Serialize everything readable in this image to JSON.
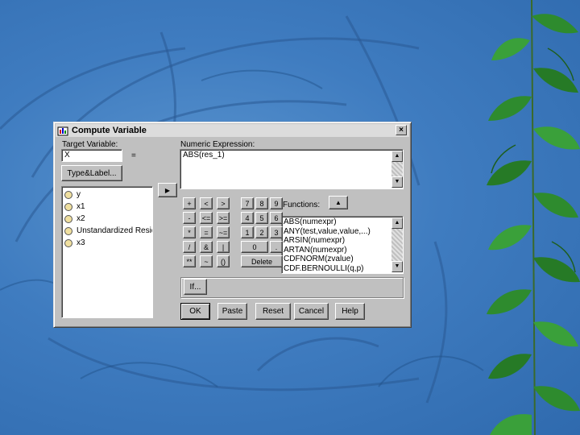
{
  "dialog": {
    "title": "Compute Variable",
    "close_label": "×",
    "target_label": "Target Variable:",
    "target_value": "X",
    "equals_label": "=",
    "type_label_button": "Type&Label...",
    "expression_label": "Numeric Expression:",
    "expression_value": "ABS(res_1)",
    "move_arrow": "▶",
    "functions_label": "Functions:",
    "functions_arrow": "▲",
    "variables": [
      {
        "label": "y"
      },
      {
        "label": "x1"
      },
      {
        "label": "x2"
      },
      {
        "label": "Unstandardized Residual"
      },
      {
        "label": "x3"
      }
    ],
    "keypad": [
      [
        "+",
        "<",
        ">",
        "7",
        "8",
        "9"
      ],
      [
        "-",
        "<=",
        ">=",
        "4",
        "5",
        "6"
      ],
      [
        "*",
        "=",
        "~=",
        "1",
        "2",
        "3"
      ],
      [
        "/",
        "&",
        "|",
        "0",
        "."
      ],
      [
        "**",
        "~",
        "()",
        "Delete"
      ]
    ],
    "functions": [
      "ABS(numexpr)",
      "ANY(test,value,value,...)",
      "ARSIN(numexpr)",
      "ARTAN(numexpr)",
      "CDFNORM(zvalue)",
      "CDF.BERNOULLI(q,p)"
    ],
    "if_button": "If...",
    "buttons": [
      "OK",
      "Paste",
      "Reset",
      "Cancel",
      "Help"
    ]
  },
  "colors": {
    "background": "#3f7cc0",
    "dialog_face": "#c0c0c0",
    "titlebar": "#dcdcdc",
    "leaf_green": "#2e8b2e"
  }
}
